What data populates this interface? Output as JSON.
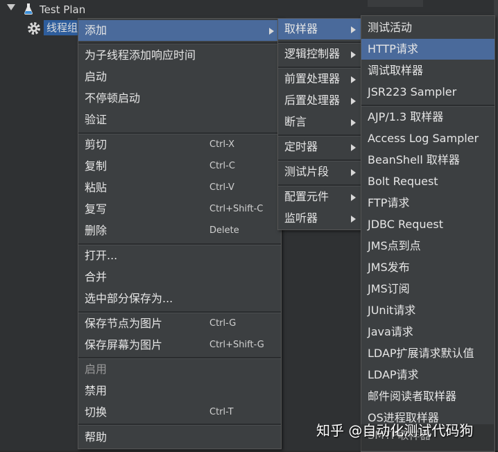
{
  "tree": {
    "root_label": "Test Plan",
    "child_label": "线程组"
  },
  "context_menu": {
    "items": [
      {
        "label": "添加",
        "shortcut": "",
        "submenu": true,
        "state": "highlighted"
      },
      {
        "label": "为子线程添加响应时间",
        "shortcut": "",
        "submenu": false,
        "state": "normal"
      },
      {
        "label": "启动",
        "shortcut": "",
        "submenu": false,
        "state": "normal"
      },
      {
        "label": "不停顿启动",
        "shortcut": "",
        "submenu": false,
        "state": "normal"
      },
      {
        "label": "验证",
        "shortcut": "",
        "submenu": false,
        "state": "normal"
      },
      {
        "label": "剪切",
        "shortcut": "Ctrl-X",
        "submenu": false,
        "state": "normal"
      },
      {
        "label": "复制",
        "shortcut": "Ctrl-C",
        "submenu": false,
        "state": "normal"
      },
      {
        "label": "粘贴",
        "shortcut": "Ctrl-V",
        "submenu": false,
        "state": "normal"
      },
      {
        "label": "复写",
        "shortcut": "Ctrl+Shift-C",
        "submenu": false,
        "state": "normal"
      },
      {
        "label": "删除",
        "shortcut": "Delete",
        "submenu": false,
        "state": "normal"
      },
      {
        "label": "打开...",
        "shortcut": "",
        "submenu": false,
        "state": "normal"
      },
      {
        "label": "合并",
        "shortcut": "",
        "submenu": false,
        "state": "normal"
      },
      {
        "label": "选中部分保存为...",
        "shortcut": "",
        "submenu": false,
        "state": "normal"
      },
      {
        "label": "保存节点为图片",
        "shortcut": "Ctrl-G",
        "submenu": false,
        "state": "normal"
      },
      {
        "label": "保存屏幕为图片",
        "shortcut": "Ctrl+Shift-G",
        "submenu": false,
        "state": "normal"
      },
      {
        "label": "启用",
        "shortcut": "",
        "submenu": false,
        "state": "disabled"
      },
      {
        "label": "禁用",
        "shortcut": "",
        "submenu": false,
        "state": "normal"
      },
      {
        "label": "切换",
        "shortcut": "Ctrl-T",
        "submenu": false,
        "state": "normal"
      },
      {
        "label": "帮助",
        "shortcut": "",
        "submenu": false,
        "state": "normal"
      }
    ]
  },
  "add_submenu": {
    "items": [
      {
        "label": "取样器",
        "state": "highlighted"
      },
      {
        "label": "逻辑控制器",
        "state": "normal"
      },
      {
        "label": "前置处理器",
        "state": "normal"
      },
      {
        "label": "后置处理器",
        "state": "normal"
      },
      {
        "label": "断言",
        "state": "normal"
      },
      {
        "label": "定时器",
        "state": "normal"
      },
      {
        "label": "测试片段",
        "state": "normal"
      },
      {
        "label": "配置元件",
        "state": "normal"
      },
      {
        "label": "监听器",
        "state": "normal"
      }
    ]
  },
  "sampler_submenu": {
    "items": [
      {
        "label": "测试活动",
        "state": "normal"
      },
      {
        "label": "HTTP请求",
        "state": "highlighted"
      },
      {
        "label": "调试取样器",
        "state": "normal"
      },
      {
        "label": "JSR223 Sampler",
        "state": "normal"
      },
      {
        "label": "AJP/1.3 取样器",
        "state": "normal"
      },
      {
        "label": "Access Log Sampler",
        "state": "normal"
      },
      {
        "label": "BeanShell 取样器",
        "state": "normal"
      },
      {
        "label": "Bolt Request",
        "state": "normal"
      },
      {
        "label": "FTP请求",
        "state": "normal"
      },
      {
        "label": "JDBC Request",
        "state": "normal"
      },
      {
        "label": "JMS点到点",
        "state": "normal"
      },
      {
        "label": "JMS发布",
        "state": "normal"
      },
      {
        "label": "JMS订阅",
        "state": "normal"
      },
      {
        "label": "JUnit请求",
        "state": "normal"
      },
      {
        "label": "Java请求",
        "state": "normal"
      },
      {
        "label": "LDAP扩展请求默认值",
        "state": "normal"
      },
      {
        "label": "LDAP请求",
        "state": "normal"
      },
      {
        "label": "邮件阅读者取样器",
        "state": "normal"
      },
      {
        "label": "OS进程取样器",
        "state": "normal"
      },
      {
        "label": "SMTP取样器",
        "state": "normal"
      }
    ]
  },
  "watermark": "知乎 @自动化测试代码狗",
  "colors": {
    "menu_bg": "#3c3f41",
    "highlight": "#4a6a9b",
    "tree_selection": "#2e5d9c",
    "text": "#e6e6e6",
    "disabled_text": "#9a9a9a"
  }
}
